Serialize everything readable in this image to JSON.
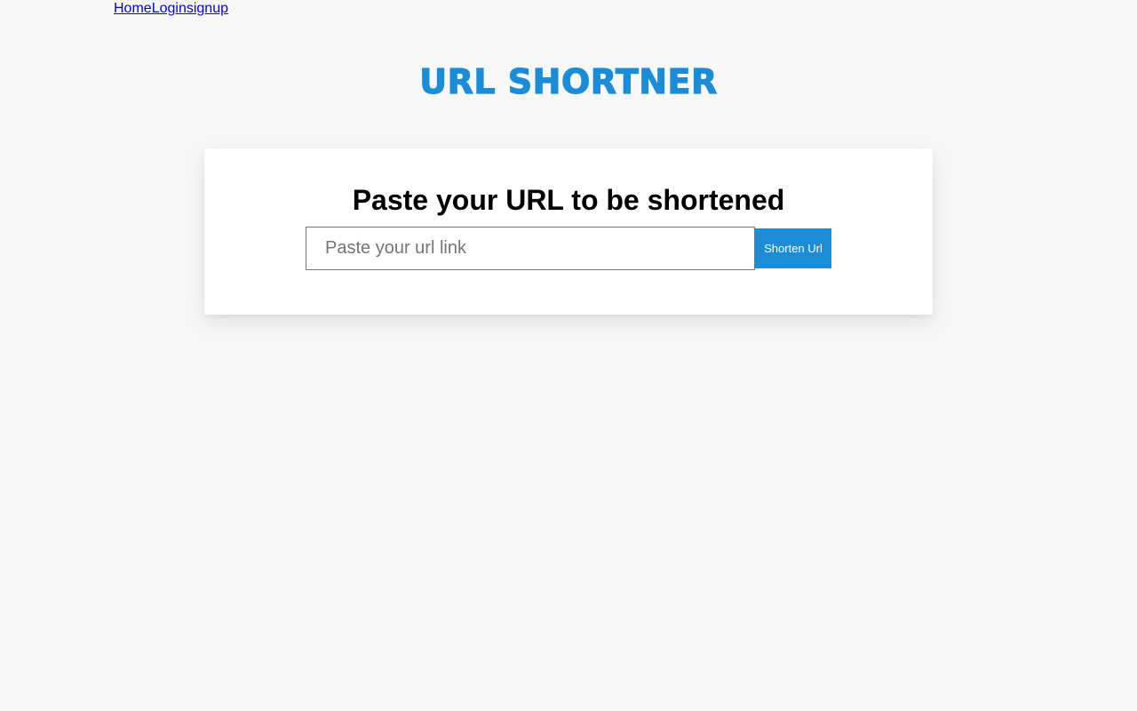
{
  "nav": {
    "items": [
      {
        "label": "Home"
      },
      {
        "label": "Login"
      },
      {
        "label": "signup"
      }
    ]
  },
  "brand": {
    "title": "URL SHORTNER",
    "color": "#1a8cd8"
  },
  "form": {
    "heading": "Paste your URL to be shortened",
    "input_placeholder": "Paste your url link",
    "input_value": "",
    "button_label": "Shorten Url",
    "button_color": "#1a8cd8"
  }
}
